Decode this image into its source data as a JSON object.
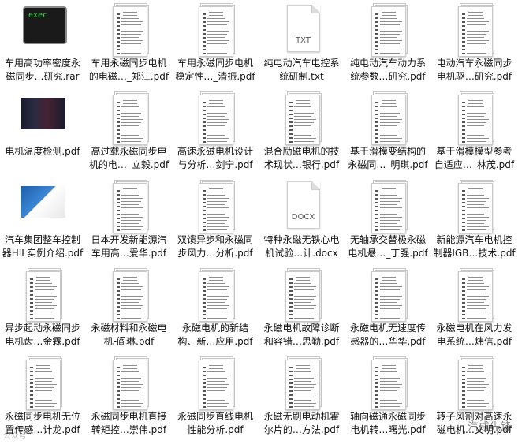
{
  "files": [
    {
      "label": "车用高功率密度永\n磁同步…研究.rar",
      "kind": "exec",
      "icon": "terminal-icon",
      "badge": "exec"
    },
    {
      "label": "车用永磁同步电机\n的电磁…_郑江.pdf",
      "kind": "pdf",
      "icon": "pdf-file-icon"
    },
    {
      "label": "车用永磁同步电机\n稳定性…_清振.pdf",
      "kind": "pdf",
      "icon": "pdf-file-icon"
    },
    {
      "label": "纯电动汽车电控系\n统研制.txt",
      "kind": "doc",
      "icon": "text-file-icon",
      "ext": "TXT"
    },
    {
      "label": "纯电动汽车动力系\n统参数…研究.pdf",
      "kind": "pdf",
      "icon": "pdf-file-icon"
    },
    {
      "label": "电动汽车永磁同步\n电机驱…研究.pdf",
      "kind": "pdf",
      "icon": "pdf-file-icon"
    },
    {
      "label": "电机温度检测.pdf",
      "kind": "shot1",
      "icon": "image-thumbnail-icon"
    },
    {
      "label": "高过载永磁同步电\n机的电…_立毅.pdf",
      "kind": "pdf",
      "icon": "pdf-file-icon"
    },
    {
      "label": "高速永磁电机设计\n与分析…剑宁.pdf",
      "kind": "pdf",
      "icon": "pdf-file-icon"
    },
    {
      "label": "混合励磁电机的技\n术现状…银行.pdf",
      "kind": "pdf",
      "icon": "pdf-file-icon"
    },
    {
      "label": "基于滑模变结构的\n永磁同…_明琪.pdf",
      "kind": "pdf",
      "icon": "pdf-file-icon"
    },
    {
      "label": "基于滑模模型参考\n自适应…_林茂.pdf",
      "kind": "pdf",
      "icon": "pdf-file-icon"
    },
    {
      "label": "汽车集团整车控制\n器HIL实例介绍.pdf",
      "kind": "shot2",
      "icon": "image-thumbnail-icon"
    },
    {
      "label": "日本开发新能源汽\n车用高…爱华.pdf",
      "kind": "pdf",
      "icon": "pdf-file-icon"
    },
    {
      "label": "双馈异步和永磁同\n步风力…分析.pdf",
      "kind": "pdf",
      "icon": "pdf-file-icon"
    },
    {
      "label": "特种永磁无铁心电\n机试验…计.docx",
      "kind": "doc",
      "icon": "docx-file-icon",
      "ext": "DOCX"
    },
    {
      "label": "无轴承交替极永磁\n电机悬…_丁强.pdf",
      "kind": "pdf",
      "icon": "pdf-file-icon"
    },
    {
      "label": "新能源汽车电机控\n制器IGB…技术.pdf",
      "kind": "pdf",
      "icon": "pdf-file-icon"
    },
    {
      "label": "异步起动永磁同步\n电机齿…金霖.pdf",
      "kind": "pdf",
      "icon": "pdf-file-icon"
    },
    {
      "label": "永磁材料和永磁电\n机-阎琳.pdf",
      "kind": "pdf",
      "icon": "pdf-file-icon"
    },
    {
      "label": "永磁电机的新结\n构、新…应用.pdf",
      "kind": "pdf",
      "icon": "pdf-file-icon"
    },
    {
      "label": "永磁电机故障诊断\n和容错…思勤.pdf",
      "kind": "pdf",
      "icon": "pdf-file-icon"
    },
    {
      "label": "永磁电机无速度传\n感器的…华华.pdf",
      "kind": "pdf",
      "icon": "pdf-file-icon"
    },
    {
      "label": "永磁电机在风力发\n电系统…炜信.pdf",
      "kind": "pdf",
      "icon": "pdf-file-icon"
    },
    {
      "label": "永磁同步电机无位\n置传感…计龙.pdf",
      "kind": "pdf",
      "icon": "pdf-file-icon"
    },
    {
      "label": "永磁同步电机直接\n转矩控…崇伟.pdf",
      "kind": "pdf",
      "icon": "pdf-file-icon"
    },
    {
      "label": "永磁同步直线电机\n性能分析.pdf",
      "kind": "pdf",
      "icon": "pdf-file-icon"
    },
    {
      "label": "永磁无刷电动机霍\n尔片的…方法.pdf",
      "kind": "pdf",
      "icon": "pdf-file-icon"
    },
    {
      "label": "轴向磁通永磁同步\n电机转…曙光.pdf",
      "kind": "pdf",
      "icon": "pdf-file-icon"
    },
    {
      "label": "转子风割对高速永\n磁电机…文明.pdf",
      "kind": "pdf",
      "icon": "pdf-file-icon"
    }
  ],
  "watermark": "汽成先锋",
  "watermark_left": "公众号"
}
